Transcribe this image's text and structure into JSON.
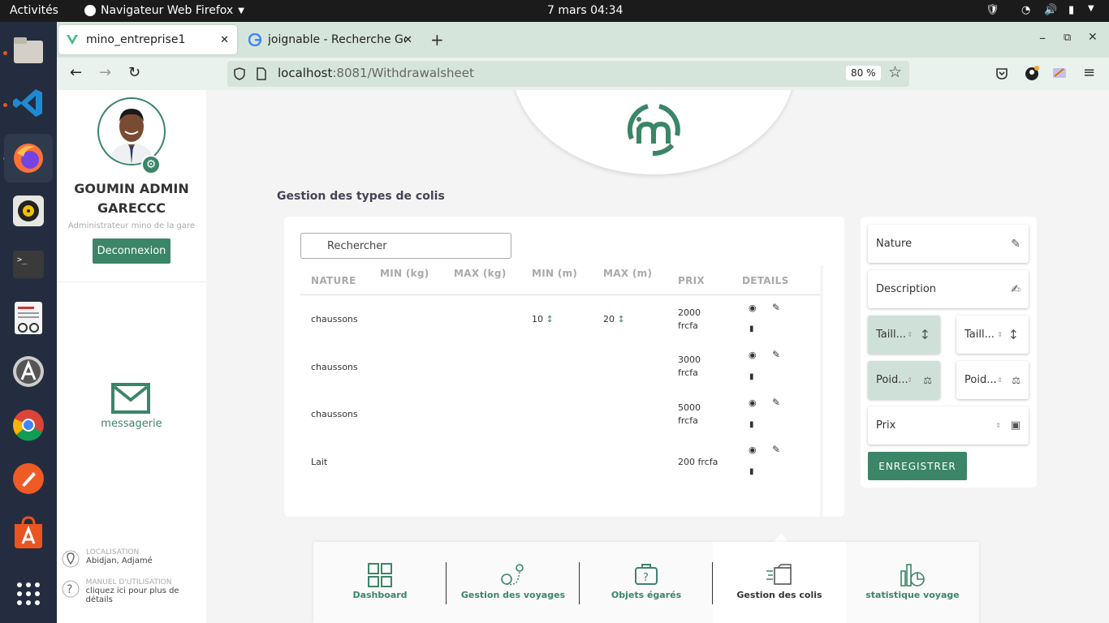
{
  "system": {
    "activities": "Activités",
    "app_name": "Navigateur Web Firefox",
    "datetime": "7 mars  04:34"
  },
  "browser": {
    "tabs": [
      {
        "title": "mino_entreprise1"
      },
      {
        "title": "joignable - Recherche Go"
      }
    ],
    "url_host": "localhost",
    "url_rest": ":8081/Withdrawalsheet",
    "zoom": "80 %"
  },
  "sidebar": {
    "user_name_line1": "GOUMIN ADMIN",
    "user_name_line2": "GARECCC",
    "user_role": "Administrateur mino de la gare",
    "logout_label": "Deconnexion",
    "messaging_label": "messagerie",
    "location_title": "LOCALISATION",
    "location_value": "Abidjan, Adjamé",
    "manual_title": "MANUEL D'UTILISATION",
    "manual_value": "cliquez ici pour plus de détails"
  },
  "main": {
    "section_title": "Gestion des types de colis",
    "search_placeholder": "Rechercher",
    "table": {
      "headers": [
        "NATURE",
        "MIN (kg)",
        "MAX (kg)",
        "MIN (m)",
        "MAX (m)",
        "PRIX",
        "DETAILS"
      ],
      "rows": [
        {
          "nature": "chaussons",
          "min_kg": "",
          "max_kg": "",
          "min_m": "10",
          "max_m": "20",
          "prix_line1": "2000",
          "prix_line2": "frcfa"
        },
        {
          "nature": "chaussons",
          "min_kg": "",
          "max_kg": "",
          "min_m": "",
          "max_m": "",
          "prix_line1": "3000",
          "prix_line2": "frcfa"
        },
        {
          "nature": "chaussons",
          "min_kg": "",
          "max_kg": "",
          "min_m": "",
          "max_m": "",
          "prix_line1": "5000",
          "prix_line2": "frcfa"
        },
        {
          "nature": "Lait",
          "min_kg": "",
          "max_kg": "",
          "min_m": "",
          "max_m": "",
          "prix_line1": "200 frcfa",
          "prix_line2": ""
        }
      ]
    }
  },
  "form": {
    "nature": "Nature",
    "description": "Description",
    "taille_min": "Taill...",
    "taille_max": "Taill...",
    "poids_min": "Poid...",
    "poids_max": "Poid...",
    "prix": "Prix",
    "save_label": "ENREGISTRER"
  },
  "bottom_nav": [
    {
      "label": "Dashboard",
      "icon": "dashboard-icon"
    },
    {
      "label": "Gestion des voyages",
      "icon": "route-icon"
    },
    {
      "label": "Objets égarés",
      "icon": "lost-luggage-icon"
    },
    {
      "label": "Gestion des colis",
      "icon": "package-icon",
      "active": true
    },
    {
      "label": "statistique voyage",
      "icon": "statistics-icon"
    }
  ],
  "colors": {
    "accent": "#3b8568",
    "tab_bar": "#d5e5dc",
    "dock": "#232d3f"
  }
}
